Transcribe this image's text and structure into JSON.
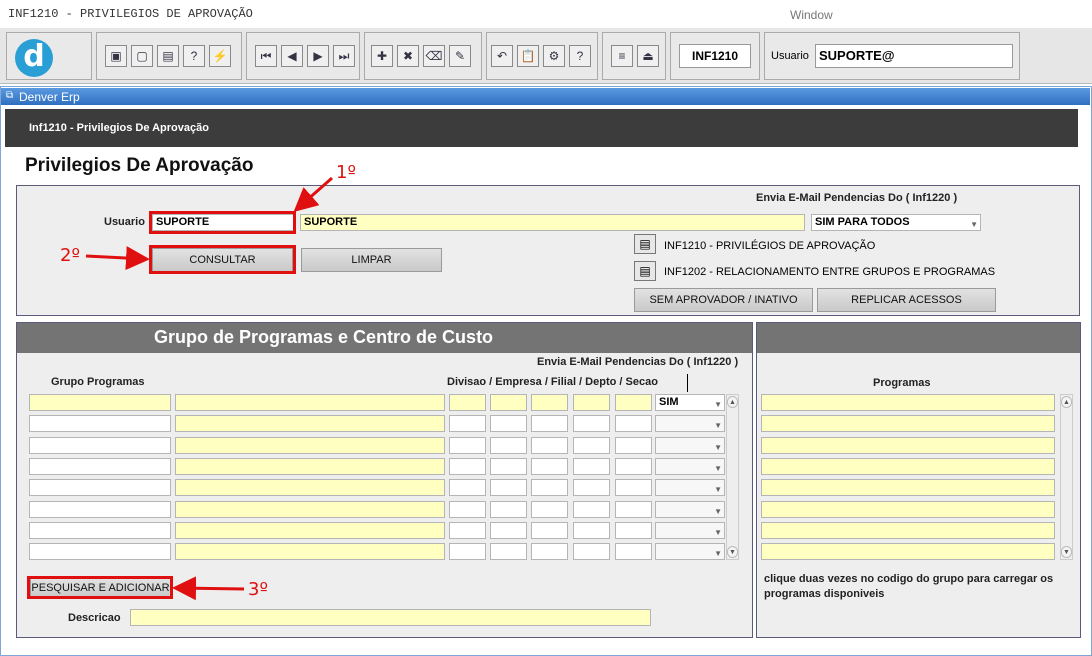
{
  "window": {
    "title": "INF1210 - PRIVILEGIOS DE APROVAÇÃO",
    "menu": "Window"
  },
  "toolbar": {
    "module_code": "INF1210",
    "user_label": "Usuario",
    "user_value": "SUPORTE@",
    "icons": [
      "logo-icon",
      "save-icon",
      "window-icon",
      "print-icon",
      "help-query-icon",
      "execute-icon",
      "first-record-icon",
      "previous-record-icon",
      "next-record-icon",
      "last-record-icon",
      "insert-record-icon",
      "delete-record-icon",
      "clear-form-icon",
      "edit-icon",
      "undo-icon",
      "clipboard-icon",
      "tools-icon",
      "help-icon",
      "menu-icon",
      "exit-icon"
    ]
  },
  "frame": {
    "title": "Denver Erp",
    "breadcrumb": "Inf1210 - Privilegios De Aprovação"
  },
  "page": {
    "title": "Privilegios De Aprovação"
  },
  "form": {
    "email_header": "Envia E-Mail Pendencias Do ( Inf1220 )",
    "usuario_label": "Usuario",
    "usuario_code": "SUPORTE",
    "usuario_name": "SUPORTE",
    "email_option": "SIM PARA TODOS",
    "consultar": "CONSULTAR",
    "limpar": "LIMPAR",
    "link1": "INF1210 - PRIVILÉGIOS DE APROVAÇÃO",
    "link2": "INF1202 - RELACIONAMENTO ENTRE GRUPOS E PROGRAMAS",
    "sem_aprovador": "SEM APROVADOR / INATIVO",
    "replicar": "REPLICAR ACESSOS"
  },
  "group_panel": {
    "title": "Grupo de Programas e Centro de Custo",
    "email_header": "Envia E-Mail Pendencias Do ( Inf1220 )",
    "col_grupo": "Grupo Programas",
    "col_divisao": "Divisao / Empresa / Filial / Depto / Secao",
    "first_row_email": "SIM",
    "pesquisar": "PESQUISAR E ADICIONAR",
    "descricao_label": "Descricao"
  },
  "programs_panel": {
    "col_programas": "Programas",
    "hint": "clique duas vezes no codigo do grupo para carregar os programas disponiveis"
  },
  "annotations": {
    "a1": "1º",
    "a2": "2º",
    "a3": "3º"
  },
  "colors": {
    "highlight": "#e01010",
    "yellow_field": "#ffffc2",
    "header_bar": "#3c3c3c",
    "frame_blue": "#2f6fc0"
  }
}
